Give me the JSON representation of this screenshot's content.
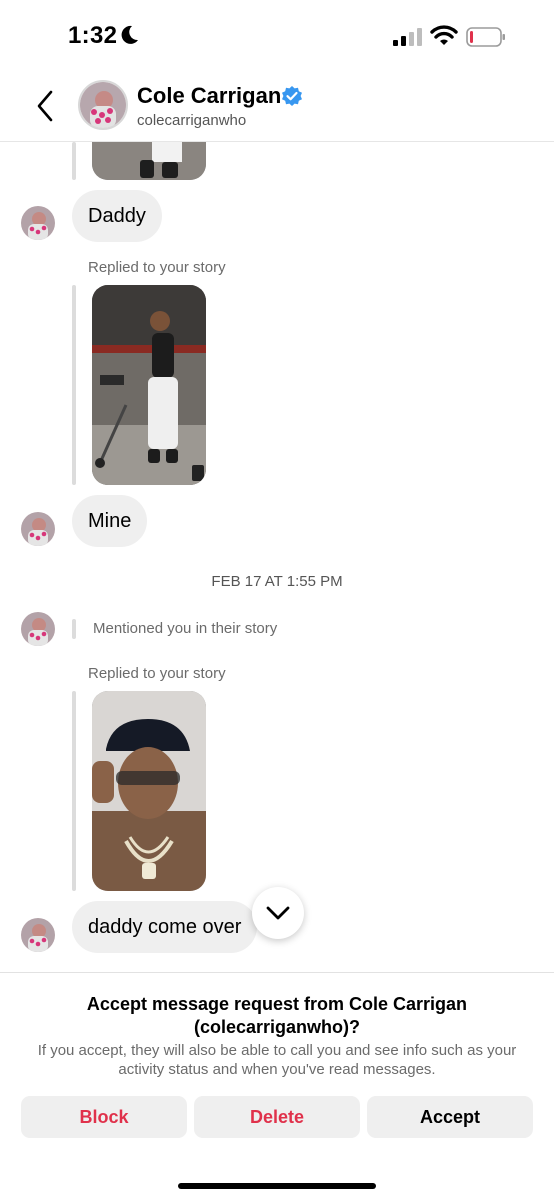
{
  "status_bar": {
    "time": "1:32",
    "icons": [
      "moon-icon",
      "signal-icon",
      "wifi-icon",
      "battery-icon"
    ],
    "battery_color": "#e0314b"
  },
  "header": {
    "name": "Cole Carrigan",
    "handle": "colecarriganwho",
    "verified_color": "#3897f0",
    "icons": [
      "back-icon",
      "verified-badge-icon"
    ]
  },
  "messages": [
    {
      "type": "text",
      "text": "Daddy"
    },
    {
      "type": "story_reply",
      "label": "Replied to your story"
    },
    {
      "type": "text",
      "text": "Mine"
    },
    {
      "type": "date",
      "text": "FEB 17 AT 1:55 PM"
    },
    {
      "type": "mention",
      "text": "Mentioned you in their story"
    },
    {
      "type": "story_reply",
      "label": "Replied to your story"
    },
    {
      "type": "text",
      "text": "daddy come over"
    }
  ],
  "request": {
    "title": "Accept message request from Cole Carrigan (colecarriganwho)?",
    "description": "If you accept, they will also be able to call you and see info such as your activity status and when you've read messages.",
    "buttons": {
      "block": "Block",
      "delete": "Delete",
      "accept": "Accept"
    },
    "danger_color": "#e0314b"
  }
}
